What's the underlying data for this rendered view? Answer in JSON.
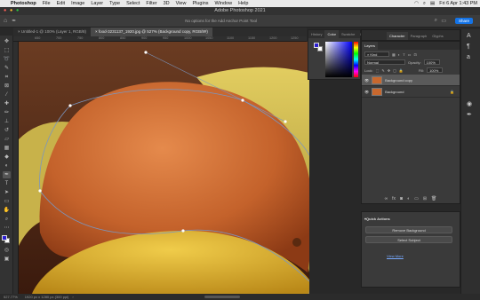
{
  "menubar": {
    "apple": "",
    "app": "Photoshop",
    "items": [
      "File",
      "Edit",
      "Image",
      "Layer",
      "Type",
      "Select",
      "Filter",
      "3D",
      "View",
      "Plugins",
      "Window",
      "Help"
    ],
    "clock": "Fri 6 Apr 1:43 PM"
  },
  "window": {
    "title": "Adobe Photoshop 2021"
  },
  "options": {
    "hint": "No options for the Add Anchor Point Tool",
    "share": "Share"
  },
  "tabs": [
    {
      "label": "Untitled-1 @ 100% (Layer 1, RGB/8)",
      "close": "×"
    },
    {
      "label": "food-3231137_1920.jpg @ 527% (Background copy, RGB/8#)",
      "close": "×"
    }
  ],
  "ruler": {
    "ticks": [
      "650",
      "700",
      "750",
      "800",
      "850",
      "900",
      "950",
      "1000",
      "1050",
      "1100",
      "1150",
      "1200",
      "1250"
    ]
  },
  "tools": [
    "move-icon",
    "marquee-icon",
    "lasso-icon",
    "quick-select-icon",
    "crop-icon",
    "frame-icon",
    "eyedropper-icon",
    "healing-icon",
    "brush-icon",
    "clone-stamp-icon",
    "history-brush-icon",
    "eraser-icon",
    "gradient-icon",
    "blur-icon",
    "dodge-icon",
    "pen-icon",
    "type-icon",
    "path-select-icon",
    "rectangle-icon",
    "hand-icon",
    "zoom-icon",
    "edit-toolbar-icon"
  ],
  "status": {
    "zoom": "527.77%",
    "size": "1920 px x 1280 px (300 ppi)"
  },
  "color_panel": {
    "tabs": [
      "History",
      "Color",
      "Swatche",
      "Libraries"
    ],
    "active": "Color",
    "foreground": "#2c1ed0",
    "background": "#ffffff",
    "picker_hue": "#0000ff"
  },
  "right_tabs": {
    "tabs": [
      "Character",
      "Paragraph",
      "Glyphs"
    ],
    "active": "Character"
  },
  "layers": {
    "title": "Layers",
    "search": "Kind",
    "blend": "Normal",
    "opacity_label": "Opacity:",
    "opacity": "100%",
    "lock_label": "Lock:",
    "fill_label": "Fill:",
    "fill": "100%",
    "rows": [
      {
        "name": "Background copy",
        "selected": true
      },
      {
        "name": "Background",
        "selected": false
      }
    ]
  },
  "actions": {
    "title": "Quick Actions",
    "buttons": [
      "Remove Background",
      "Select Subject"
    ],
    "link": "View More"
  },
  "colors": {
    "orange": "#c8682e",
    "lemon": "#e0b62a",
    "banana": "#d7c24f",
    "path": "#7a96c0"
  }
}
